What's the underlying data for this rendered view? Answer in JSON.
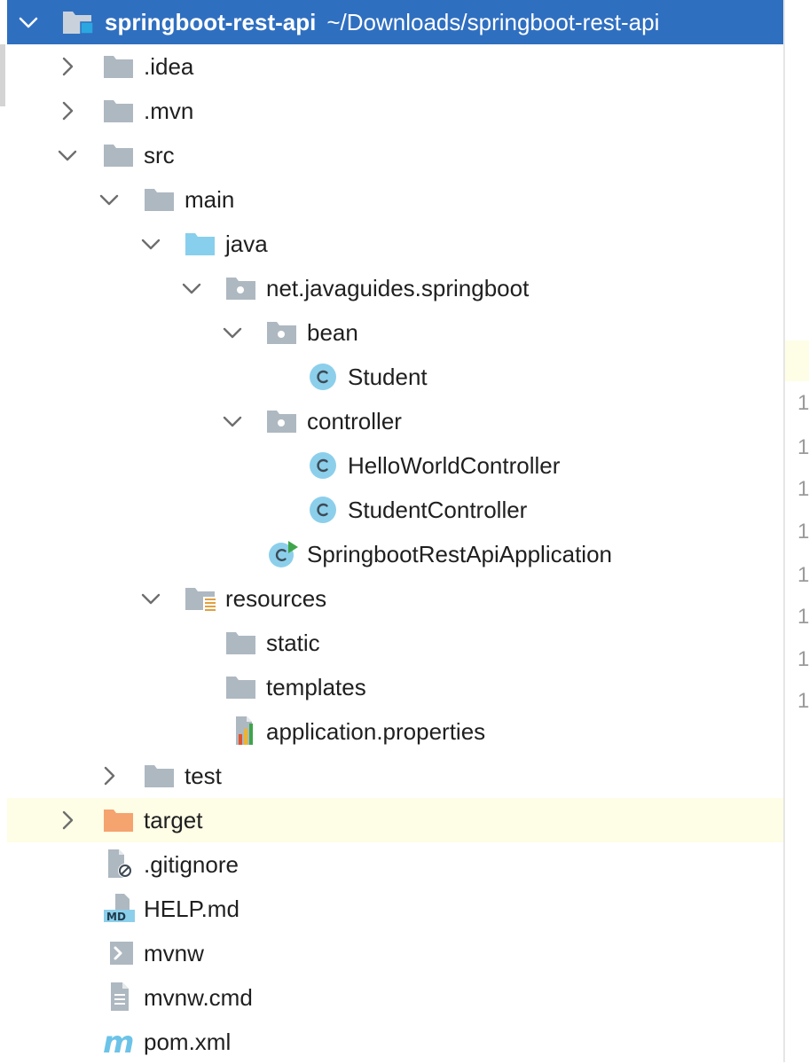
{
  "project": {
    "name": "springboot-rest-api",
    "path": "~/Downloads/springboot-rest-api"
  },
  "tree": [
    {
      "label": ".idea",
      "icon": "folder-icon",
      "expanded": false
    },
    {
      "label": ".mvn",
      "icon": "folder-icon",
      "expanded": false
    },
    {
      "label": "src",
      "icon": "folder-icon",
      "expanded": true
    },
    {
      "label": "main",
      "icon": "folder-icon",
      "expanded": true
    },
    {
      "label": "java",
      "icon": "source-folder-icon",
      "expanded": true
    },
    {
      "label": "net.javaguides.springboot",
      "icon": "package-icon",
      "expanded": true
    },
    {
      "label": "bean",
      "icon": "package-icon",
      "expanded": true
    },
    {
      "label": "Student",
      "icon": "class-icon"
    },
    {
      "label": "controller",
      "icon": "package-icon",
      "expanded": true
    },
    {
      "label": "HelloWorldController",
      "icon": "class-icon"
    },
    {
      "label": "StudentController",
      "icon": "class-icon"
    },
    {
      "label": "SpringbootRestApiApplication",
      "icon": "spring-app-class-icon"
    },
    {
      "label": "resources",
      "icon": "resources-folder-icon",
      "expanded": true
    },
    {
      "label": "static",
      "icon": "folder-icon"
    },
    {
      "label": "templates",
      "icon": "folder-icon"
    },
    {
      "label": "application.properties",
      "icon": "properties-file-icon"
    },
    {
      "label": "test",
      "icon": "folder-icon",
      "expanded": false
    },
    {
      "label": "target",
      "icon": "excluded-folder-icon",
      "expanded": false
    },
    {
      "label": ".gitignore",
      "icon": "ignore-file-icon"
    },
    {
      "label": "HELP.md",
      "icon": "markdown-file-icon"
    },
    {
      "label": "mvnw",
      "icon": "shell-script-icon"
    },
    {
      "label": "mvnw.cmd",
      "icon": "text-file-icon"
    },
    {
      "label": "pom.xml",
      "icon": "maven-icon"
    }
  ],
  "gutter_lines": [
    "1",
    "1",
    "1",
    "1",
    "1",
    "1",
    "1",
    "1"
  ],
  "colors": {
    "selection": "#2f6fc0",
    "folder": "#aeb8c1",
    "source_folder": "#87cfec",
    "excluded_folder": "#f5a36f",
    "class": "#8ccfeb",
    "spring_green": "#3fa54a",
    "highlight": "#fefde6"
  }
}
